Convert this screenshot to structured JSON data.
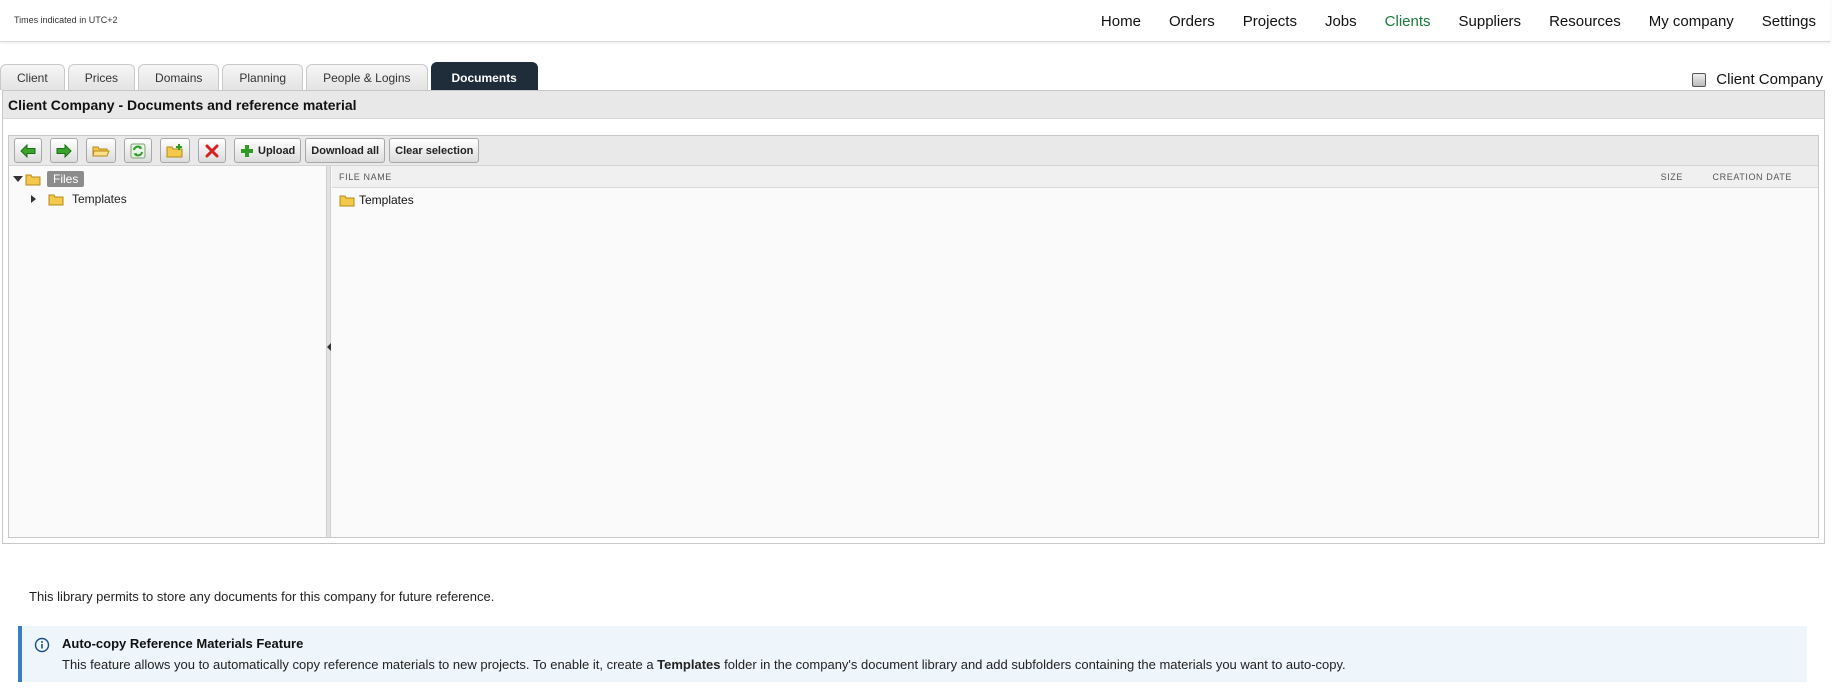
{
  "header": {
    "timezone_note": "Times indicated in UTC+2",
    "nav": [
      {
        "label": "Home",
        "active": false
      },
      {
        "label": "Orders",
        "active": false
      },
      {
        "label": "Projects",
        "active": false
      },
      {
        "label": "Jobs",
        "active": false
      },
      {
        "label": "Clients",
        "active": true
      },
      {
        "label": "Suppliers",
        "active": false
      },
      {
        "label": "Resources",
        "active": false
      },
      {
        "label": "My company",
        "active": false
      },
      {
        "label": "Settings",
        "active": false
      }
    ],
    "active_color": "#1a7a3c"
  },
  "tabs": [
    {
      "label": "Client"
    },
    {
      "label": "Prices"
    },
    {
      "label": "Domains"
    },
    {
      "label": "Planning"
    },
    {
      "label": "People & Logins"
    },
    {
      "label": "Documents",
      "active": true
    }
  ],
  "company_name": "Client Company",
  "panel": {
    "title": "Client Company - Documents and reference material"
  },
  "toolbar": {
    "icons": [
      "back-arrow-icon",
      "forward-arrow-icon",
      "open-folder-icon",
      "refresh-icon",
      "new-folder-icon",
      "delete-icon"
    ],
    "upload_label": "Upload",
    "download_all_label": "Download all",
    "clear_selection_label": "Clear selection"
  },
  "tree": {
    "root_label": "Files",
    "children": [
      {
        "label": "Templates"
      }
    ]
  },
  "file_list": {
    "columns": {
      "name": "FILE NAME",
      "size": "SIZE",
      "created": "CREATION DATE"
    },
    "rows": [
      {
        "name": "Templates",
        "size": "",
        "created": ""
      }
    ]
  },
  "description": "This library permits to store any documents for this company for future reference.",
  "info": {
    "title": "Auto-copy Reference Materials Feature",
    "body_before": "This feature allows you to automatically copy reference materials to new projects. To enable it, create a ",
    "body_bold": "Templates",
    "body_after": " folder in the company's document library and add subfolders containing the materials you want to auto-copy.",
    "accent": "#3a7fc3"
  }
}
